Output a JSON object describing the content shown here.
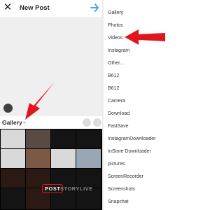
{
  "header": {
    "title": "New Post"
  },
  "gallery": {
    "label": "Gallery"
  },
  "tabs": {
    "post": "POST",
    "story": "STORY",
    "live": "LIVE"
  },
  "menu": {
    "items": [
      "Gallery",
      "Photos",
      "Videos",
      "Instagram",
      "Other...",
      "B612",
      "B612",
      "Camera",
      "Download",
      "FastSave",
      "InstagramDownloader",
      "InStore Downloader",
      "pictures",
      "ScreenRecorder",
      "Screenshots",
      "Snapchat"
    ]
  },
  "colors": {
    "accent": "#3897f0",
    "arrow": "#e0151e"
  }
}
